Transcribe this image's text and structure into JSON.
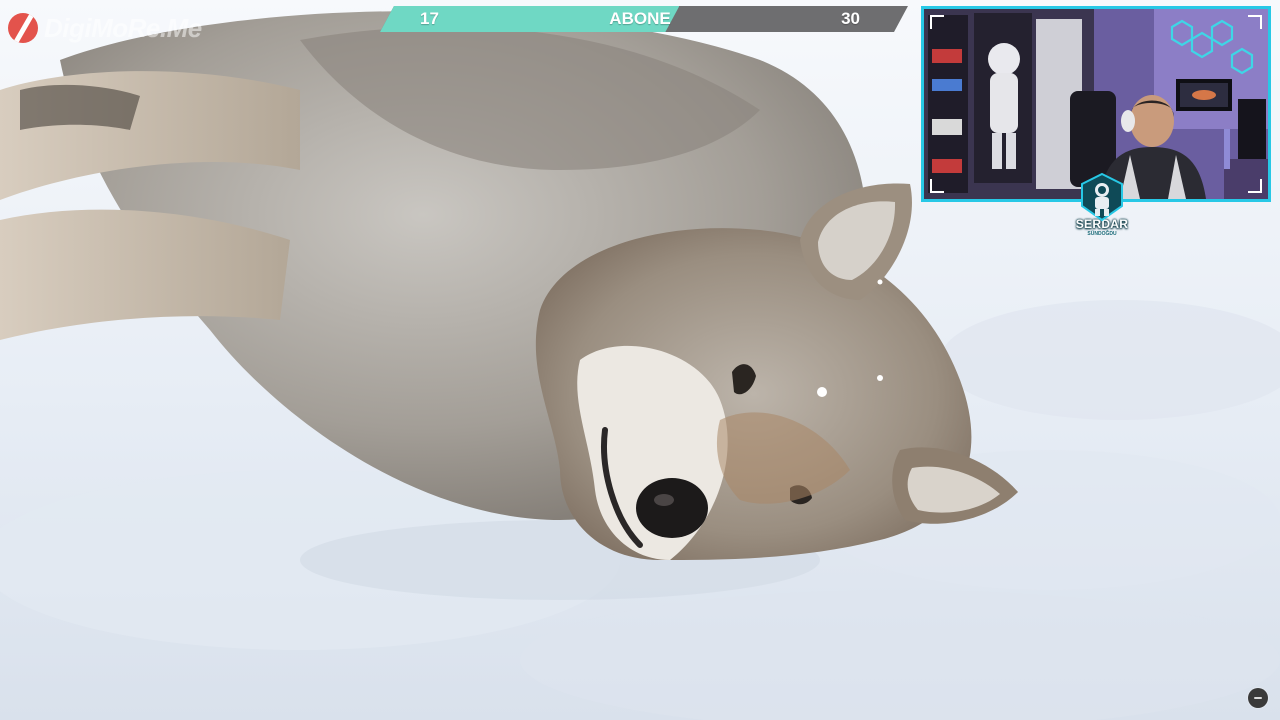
{
  "watermark": {
    "text": "DigiMoRe.Me",
    "logo_icon": "slash-circle-logo-icon",
    "logo_color": "#e2423a"
  },
  "goal_bar": {
    "current": "17",
    "label": "ABONE",
    "target": "30",
    "progress_fraction": 0.567,
    "fill_color": "#6fd8c4",
    "track_color": "#6e6e70"
  },
  "webcam": {
    "border_color": "#27c8e6",
    "accent_color": "#27c8e6"
  },
  "badge": {
    "name": "SERDAR",
    "subtitle": "SÜNDOĞDU",
    "icon": "astronaut-icon"
  },
  "player": {
    "corner_button_icon": "minus-circle-icon"
  }
}
